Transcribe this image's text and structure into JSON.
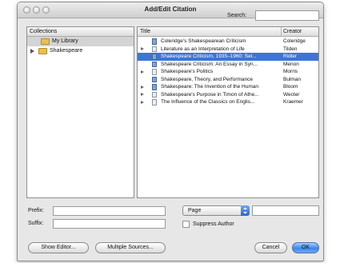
{
  "window": {
    "title": "Add/Edit Citation"
  },
  "search": {
    "label": "Search:",
    "value": ""
  },
  "collections": {
    "header": "Collections",
    "items": [
      {
        "label": "My Library"
      },
      {
        "label": "Shakespeare"
      }
    ]
  },
  "items_table": {
    "headers": {
      "title": "Title",
      "creator": "Creator"
    },
    "rows": [
      {
        "title": "Coleridge's Shakespearean Criticism",
        "creator": "Coleridge"
      },
      {
        "title": "Literature as an Interpretation of Life",
        "creator": "Tilden"
      },
      {
        "title": "Shakespeare Criticism, 1935–1960: Sel...",
        "creator": "Ridler"
      },
      {
        "title": "Shakespeare Criticism: An Essay in Syn...",
        "creator": "Menon"
      },
      {
        "title": "Shakespeare's Politics",
        "creator": "Morris"
      },
      {
        "title": "Shakespeare, Theory, and Performance",
        "creator": "Bulman"
      },
      {
        "title": "Shakespeare: The Invention of the Human",
        "creator": "Bloom"
      },
      {
        "title": "Shakespeare's Purpose in Timon of Athe...",
        "creator": "Wecter"
      },
      {
        "title": "The Influence of the Classics on Englis...",
        "creator": "Kraemer"
      }
    ]
  },
  "form": {
    "prefix_label": "Prefix:",
    "suffix_label": "Suffix:",
    "locator_selected": "Page",
    "suppress_author_label": "Suppress Author"
  },
  "buttons": {
    "show_editor": "Show Editor...",
    "multiple_sources": "Multiple Sources...",
    "cancel": "Cancel",
    "ok": "OK"
  }
}
